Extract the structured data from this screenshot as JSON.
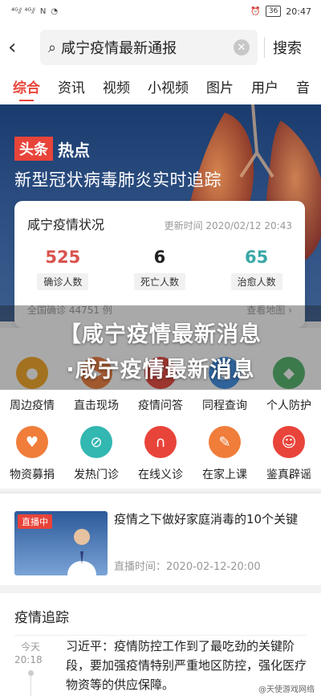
{
  "status_bar": {
    "signal_left": "⁴ᴳ⫽ ⁴ᴳ⫽",
    "network": "N",
    "battery": "36",
    "time": "20:47"
  },
  "search": {
    "query": "咸宁疫情最新通报",
    "button": "搜索"
  },
  "tabs": [
    "综合",
    "资讯",
    "视频",
    "小视频",
    "图片",
    "用户",
    "音"
  ],
  "hero": {
    "brand_red": "头条",
    "brand_white": "热点",
    "title": "新型冠状病毒肺炎实时追踪"
  },
  "status_card": {
    "title": "咸宁疫情状况",
    "update_time": "更新时间 2020/02/12 20:43",
    "stats": [
      {
        "value": "525",
        "label": "确诊人数",
        "color": "#d9534f"
      },
      {
        "value": "6",
        "label": "死亡人数",
        "color": "#222222"
      },
      {
        "value": "65",
        "label": "治愈人数",
        "color": "#3aa8a8"
      }
    ],
    "footer_left": "全国确诊 44751 例",
    "footer_right": "查看地图 ›"
  },
  "overlay": {
    "line1": "【咸宁疫情最新消息",
    "line2": "·咸宁疫情最新消息"
  },
  "grid": {
    "row1": [
      {
        "label": "周边疫情",
        "icon": "location-icon",
        "color": "#f5a623"
      },
      {
        "label": "直击现场",
        "icon": "camera-icon",
        "color": "#f07d3a"
      },
      {
        "label": "疫情问答",
        "icon": "chat-icon",
        "color": "#e8443a"
      },
      {
        "label": "同程查询",
        "icon": "train-icon",
        "color": "#3a8ee6"
      },
      {
        "label": "个人防护",
        "icon": "shield-icon",
        "color": "#4fb46a"
      }
    ],
    "row2": [
      {
        "label": "物资募捐",
        "icon": "heart-icon",
        "color": "#f07d3a"
      },
      {
        "label": "发热门诊",
        "icon": "thermometer-icon",
        "color": "#33b7b1"
      },
      {
        "label": "在线义诊",
        "icon": "stethoscope-icon",
        "color": "#e8443a"
      },
      {
        "label": "在家上课",
        "icon": "pencil-icon",
        "color": "#f07d3a"
      },
      {
        "label": "鉴真辟谣",
        "icon": "person-icon",
        "color": "#e8443a"
      }
    ]
  },
  "news": {
    "badge": "直播中",
    "title": "疫情之下做好家庭消毒的10个关键",
    "time": "直播时间：2020-02-12-20:00"
  },
  "tracking": {
    "title": "疫情追踪",
    "day": "今天",
    "hour": "20:18",
    "text": "习近平：疫情防控工作到了最吃劲的关键阶段，要加强疫情特别严重地区防控，强化医疗物资等的供应保障。",
    "watermark": "@天使游戏网络"
  }
}
